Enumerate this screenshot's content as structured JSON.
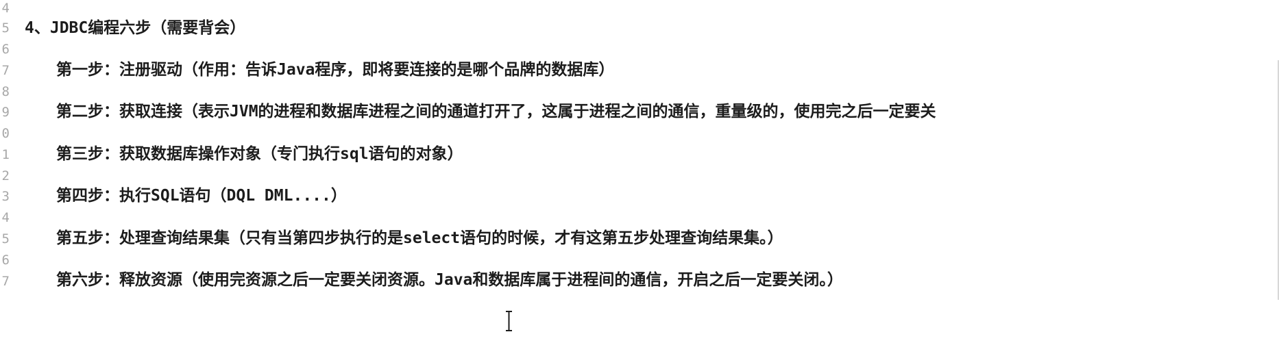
{
  "editor": {
    "line_numbers": [
      "4",
      "5",
      "6",
      "7",
      "8",
      "9",
      "0",
      "1",
      "2",
      "3",
      "4",
      "5",
      "6",
      "7"
    ],
    "heading": "4、JDBC编程六步（需要背会）",
    "steps": [
      "第一步：注册驱动（作用：告诉Java程序，即将要连接的是哪个品牌的数据库）",
      "第二步：获取连接（表示JVM的进程和数据库进程之间的通道打开了，这属于进程之间的通信，重量级的，使用完之后一定要关",
      "第三步：获取数据库操作对象（专门执行sql语句的对象）",
      "第四步：执行SQL语句（DQL DML....）",
      "第五步：处理查询结果集（只有当第四步执行的是select语句的时候，才有这第五步处理查询结果集。）",
      "第六步：释放资源（使用完资源之后一定要关闭资源。Java和数据库属于进程间的通信，开启之后一定要关闭。）"
    ],
    "cursor_icon": "text-ibeam-icon"
  }
}
